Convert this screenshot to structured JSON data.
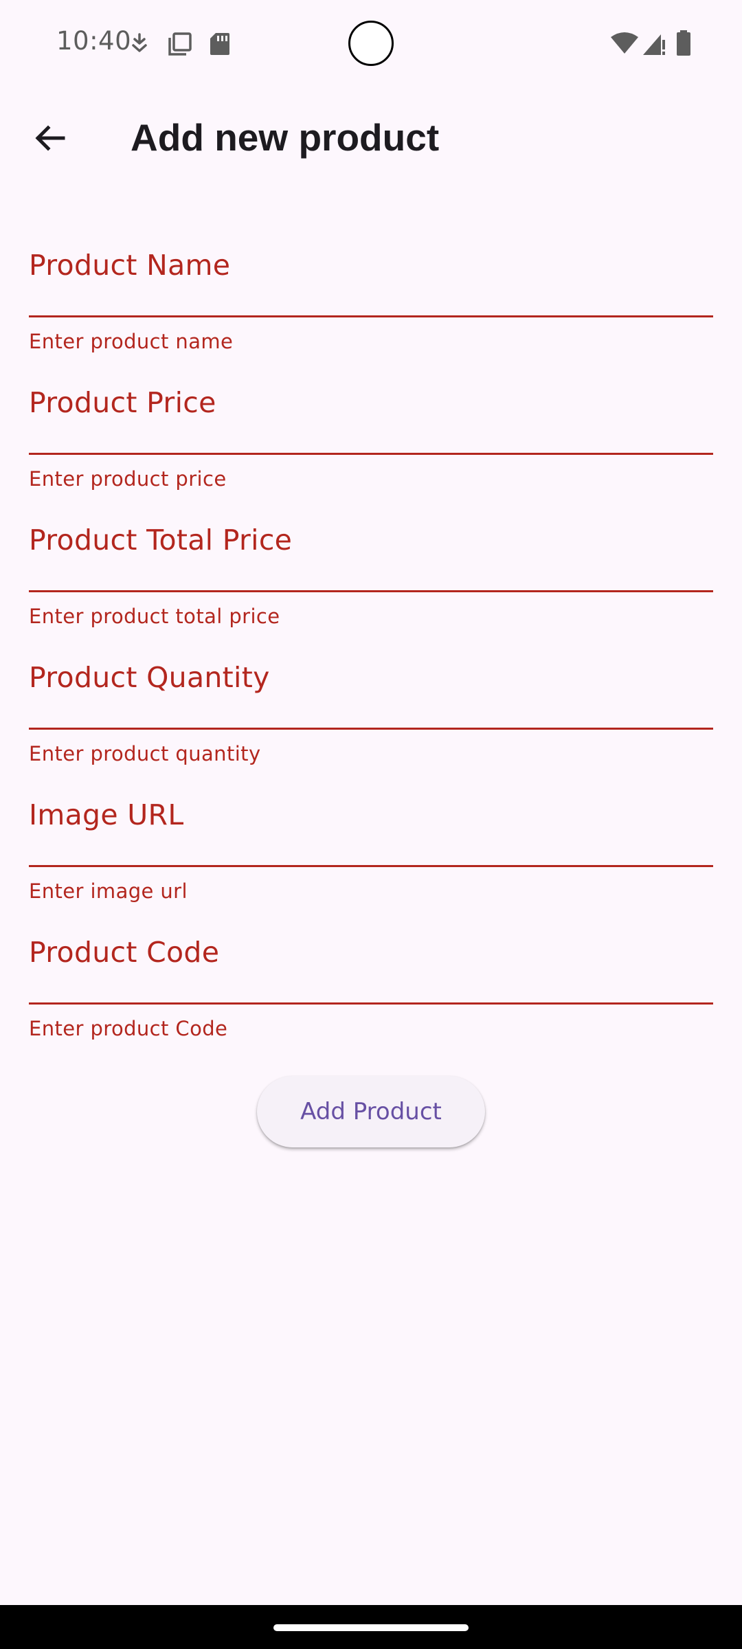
{
  "status_bar": {
    "time": "10:40",
    "left_icons": [
      "download-icon",
      "copy-icon",
      "sd-card-icon"
    ],
    "right_icons": [
      "wifi-icon",
      "signal-icon",
      "battery-icon"
    ]
  },
  "app_bar": {
    "title": "Add new product",
    "back_icon": "arrow-back-icon"
  },
  "form": {
    "fields": [
      {
        "label": "Product Name",
        "value": "",
        "helper": "Enter product name"
      },
      {
        "label": "Product Price",
        "value": "",
        "helper": "Enter product price"
      },
      {
        "label": "Product Total Price",
        "value": "",
        "helper": "Enter product total price"
      },
      {
        "label": "Product Quantity",
        "value": "",
        "helper": "Enter product quantity"
      },
      {
        "label": "Image URL",
        "value": "",
        "helper": "Enter image url"
      },
      {
        "label": "Product Code",
        "value": "",
        "helper": "Enter product Code"
      }
    ],
    "submit_label": "Add Product"
  },
  "colors": {
    "background": "#fdf7fd",
    "error": "#b3261e",
    "primary": "#6750a4",
    "title_text": "#1d1b20"
  }
}
